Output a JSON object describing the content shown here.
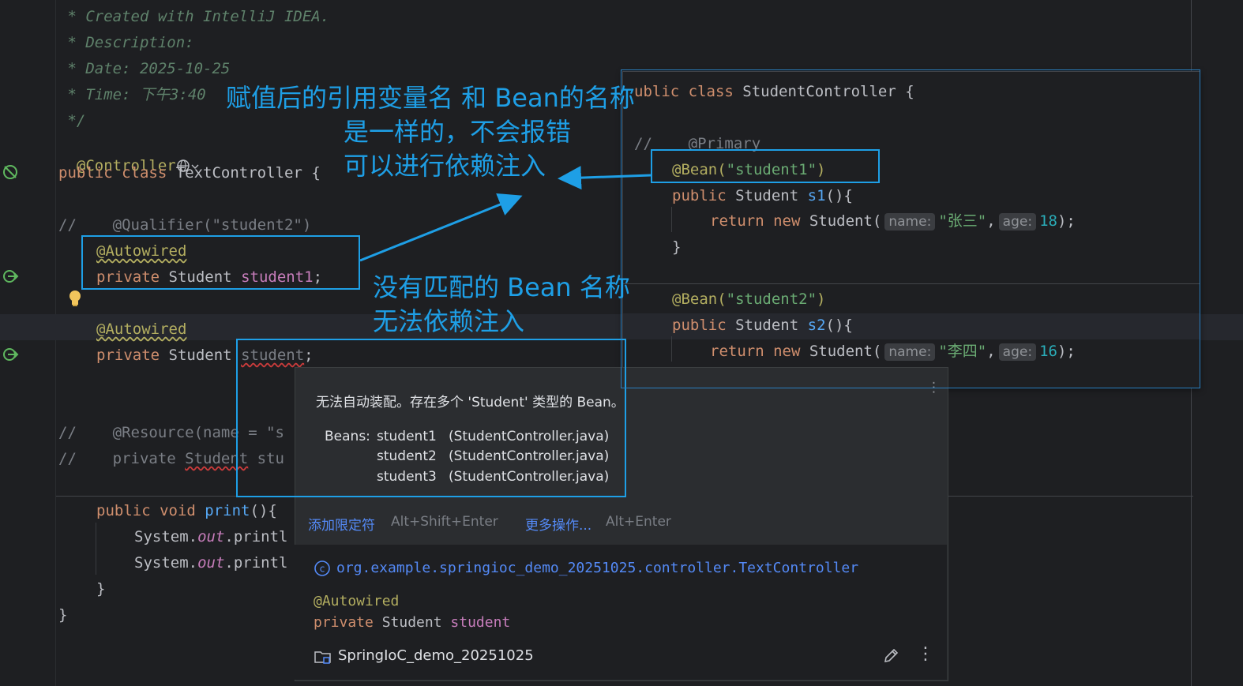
{
  "editor": {
    "doc_lines": [
      " * Created with IntelliJ IDEA.",
      " * Description:",
      " * Date: 2025-10-25",
      " * Time: 下午3:40",
      " */"
    ],
    "controller_annotation": "@Controller",
    "class_decl": {
      "kw": "public class",
      "name": "TextController",
      "brace": "{"
    },
    "qualifier_comment": "//    @Qualifier(\"student2\")",
    "autowired": "@Autowired",
    "field1": {
      "kw": "private",
      "type": "Student",
      "name": "student1",
      "end": ";"
    },
    "field2": {
      "kw": "private",
      "type": "Student",
      "name": "student",
      "end": ";"
    },
    "resource_comment": "//    @Resource(name = \"s",
    "resource_field_comment": {
      "prefix": "//    private ",
      "type": "Student",
      "rest": " stu"
    },
    "print_method": {
      "kw": "public void",
      "name": "print",
      "rest": "(){"
    },
    "sysout1": {
      "a": "System.",
      "b": "out",
      "c": ".printl"
    },
    "sysout2": {
      "a": "System.",
      "b": "out",
      "c": ".printl"
    },
    "close_brace_inner": "}",
    "close_brace_outer": "}"
  },
  "overlay": {
    "class_decl": {
      "kw": "ublic class",
      "name": "StudentController",
      "brace": "{"
    },
    "primary_comment": {
      "slashes": "//",
      "ann": "@Primary"
    },
    "bean1": {
      "ann": "@Bean(",
      "str": "\"student1\"",
      "end": ")"
    },
    "method1": {
      "kw": "public",
      "type": "Student",
      "name": "s1",
      "rest": "(){"
    },
    "return1": {
      "kw": "return new",
      "type": "Student(",
      "hint_name": "name:",
      "str": "\"张三\"",
      "hint_age": "age:",
      "num": "18",
      "end": ");"
    },
    "close1": "}",
    "bean2": {
      "ann": "@Bean(",
      "str": "\"student2\"",
      "end": ")"
    },
    "method2": {
      "kw": "public",
      "type": "Student",
      "name": "s2",
      "rest": "(){"
    },
    "return2": {
      "kw": "return new",
      "type": "Student(",
      "hint_name": "name:",
      "str": "\"李四\"",
      "hint_age": "age:",
      "num": "16",
      "end": ");"
    },
    "close2": "}"
  },
  "popup": {
    "message": "无法自动装配。存在多个 'Student' 类型的 Bean。",
    "beans_label": "Beans:",
    "beans": [
      {
        "name": "student1",
        "file": "(StudentController.java)"
      },
      {
        "name": "student2",
        "file": "(StudentController.java)"
      },
      {
        "name": "student3",
        "file": "(StudentController.java)"
      }
    ],
    "action1": "添加限定符",
    "action1_key": "Alt+Shift+Enter",
    "action2": "更多操作...",
    "action2_key": "Alt+Enter",
    "class_path": "org.example.springioc_demo_20251025.controller.TextController",
    "doc_ann": "@Autowired",
    "doc_field": {
      "kw": "private",
      "type": "Student",
      "name": "student"
    },
    "project": "SpringIoC_demo_20251025"
  },
  "annotations": {
    "top_note": [
      "赋值后的引用变量名 和 Bean的名称",
      "是一样的，不会报错",
      "可以进行依赖注入"
    ],
    "mid_note": [
      "没有匹配的 Bean 名称",
      "无法依赖注入"
    ]
  },
  "colors": {
    "accent": "#1e9fe6",
    "editor_bg": "#1e1f22",
    "popup_bg": "#2b2d30"
  }
}
